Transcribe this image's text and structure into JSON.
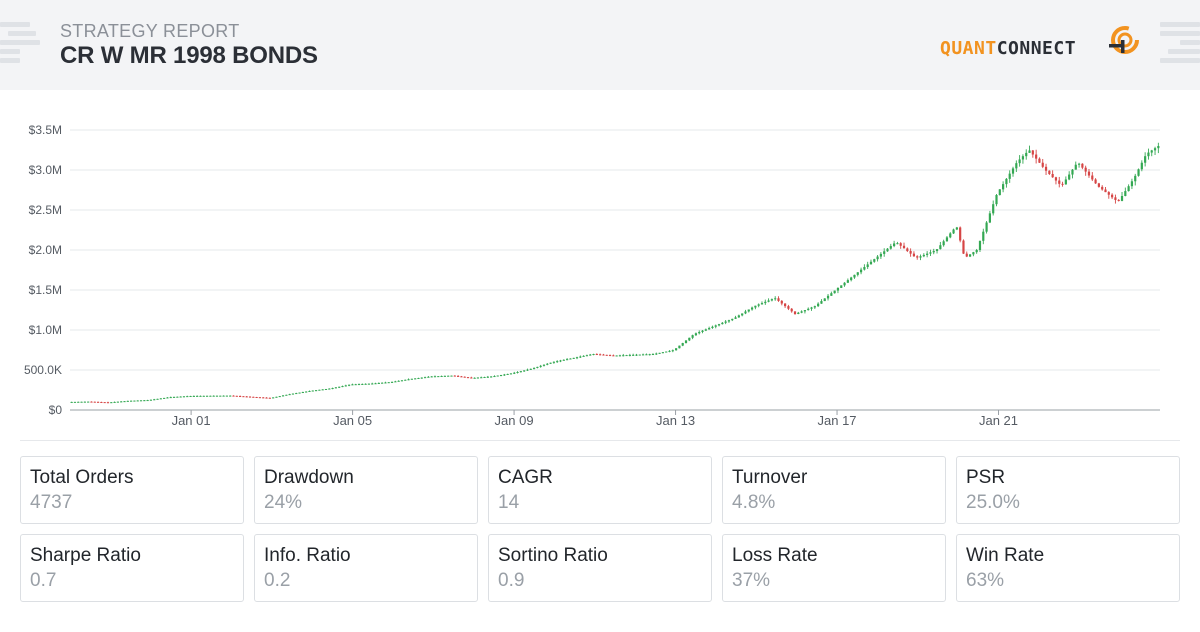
{
  "header": {
    "subtitle": "STRATEGY REPORT",
    "title": "CR W MR 1998 BONDS",
    "logo": {
      "part1": "QUANT",
      "part2": "CONNECT",
      "icon": "quantconnect-logo-icon"
    }
  },
  "chart_data": {
    "type": "candlestick",
    "title": "",
    "xlabel": "",
    "ylabel": "",
    "y_ticks": [
      "$0",
      "500.0K",
      "$1.0M",
      "$1.5M",
      "$2.0M",
      "$2.5M",
      "$3.0M",
      "$3.5M"
    ],
    "y_tick_values": [
      0,
      500000,
      1000000,
      1500000,
      2000000,
      2500000,
      3000000,
      3500000
    ],
    "ylim": [
      0,
      3500000
    ],
    "x_ticks": [
      "Jan 01",
      "Jan 05",
      "Jan 09",
      "Jan 13",
      "Jan 17",
      "Jan 21"
    ],
    "x_tick_years": [
      2001,
      2005,
      2009,
      2013,
      2017,
      2021
    ],
    "xlim": [
      1998.0,
      2025.0
    ],
    "grid": true,
    "colors": {
      "up": "#34a853",
      "down": "#d64545"
    },
    "series": [
      {
        "name": "",
        "x": [
          1998.0,
          1998.5,
          1999.0,
          1999.5,
          2000.0,
          2000.5,
          2001.0,
          2001.5,
          2002.0,
          2002.5,
          2003.0,
          2003.5,
          2004.0,
          2004.5,
          2005.0,
          2005.5,
          2006.0,
          2006.5,
          2007.0,
          2007.5,
          2008.0,
          2008.5,
          2009.0,
          2009.5,
          2010.0,
          2010.5,
          2011.0,
          2011.5,
          2012.0,
          2012.5,
          2013.0,
          2013.5,
          2014.0,
          2014.5,
          2015.0,
          2015.5,
          2016.0,
          2016.5,
          2017.0,
          2017.5,
          2018.0,
          2018.5,
          2019.0,
          2019.5,
          2020.0,
          2020.2,
          2020.5,
          2021.0,
          2021.5,
          2021.8,
          2022.2,
          2022.6,
          2023.0,
          2023.5,
          2024.0,
          2024.4,
          2024.7,
          2025.0
        ],
        "values": [
          100000,
          105000,
          95000,
          115000,
          125000,
          160000,
          175000,
          178000,
          180000,
          165000,
          150000,
          200000,
          240000,
          270000,
          320000,
          330000,
          350000,
          390000,
          420000,
          430000,
          400000,
          420000,
          460000,
          520000,
          600000,
          650000,
          700000,
          680000,
          690000,
          700000,
          750000,
          950000,
          1050000,
          1150000,
          1300000,
          1400000,
          1200000,
          1300000,
          1500000,
          1700000,
          1900000,
          2100000,
          1900000,
          2000000,
          2300000,
          1900000,
          2000000,
          2700000,
          3100000,
          3250000,
          3000000,
          2800000,
          3100000,
          2800000,
          2600000,
          2900000,
          3200000,
          3300000
        ]
      }
    ]
  },
  "stats": [
    {
      "label": "Total Orders",
      "value": "4737"
    },
    {
      "label": "Drawdown",
      "value": "24%"
    },
    {
      "label": "CAGR",
      "value": "14"
    },
    {
      "label": "Turnover",
      "value": "4.8%"
    },
    {
      "label": "PSR",
      "value": "25.0%"
    },
    {
      "label": "Sharpe Ratio",
      "value": "0.7"
    },
    {
      "label": "Info. Ratio",
      "value": "0.2"
    },
    {
      "label": "Sortino Ratio",
      "value": "0.9"
    },
    {
      "label": "Loss Rate",
      "value": "37%"
    },
    {
      "label": "Win Rate",
      "value": "63%"
    }
  ]
}
